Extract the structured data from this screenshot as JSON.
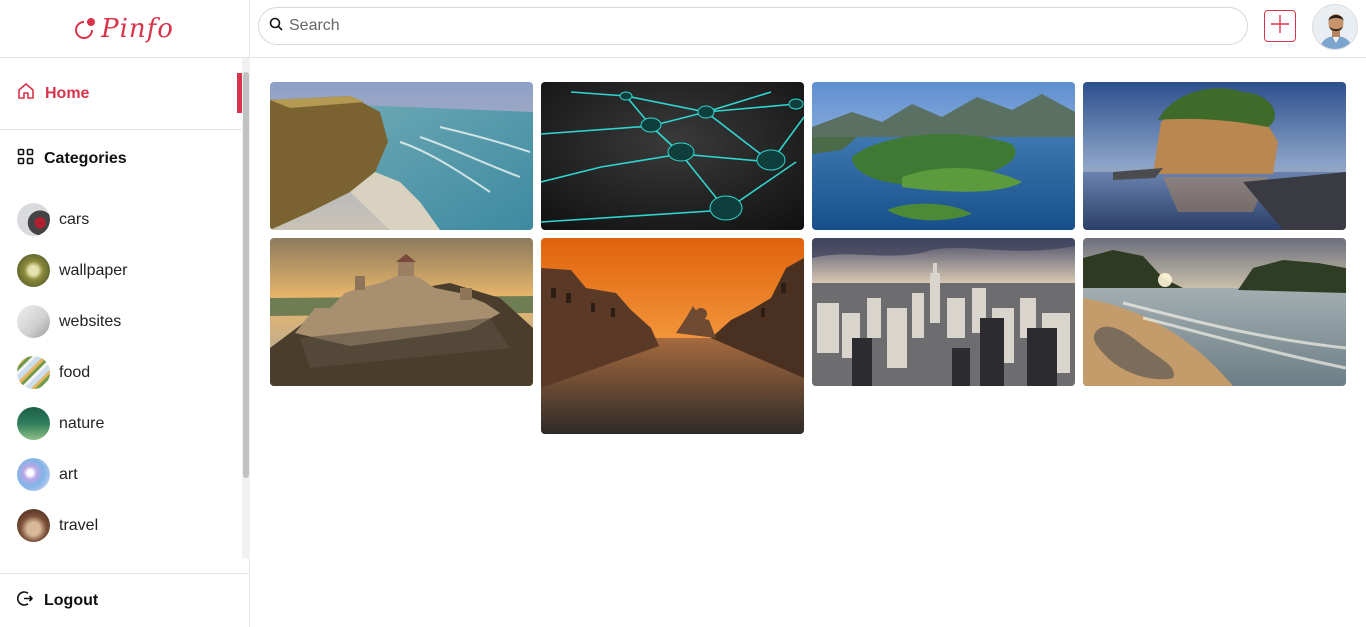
{
  "app": {
    "logo_text": "Pinfo",
    "brand_color": "#d8344b"
  },
  "sidebar": {
    "home_label": "Home",
    "categories_label": "Categories",
    "categories": [
      {
        "label": "cars"
      },
      {
        "label": "wallpaper"
      },
      {
        "label": "websites"
      },
      {
        "label": "food"
      },
      {
        "label": "nature"
      },
      {
        "label": "art"
      },
      {
        "label": "travel"
      }
    ],
    "logout_label": "Logout"
  },
  "search": {
    "placeholder": "Search",
    "value": ""
  },
  "header": {
    "add_icon": "plus-icon",
    "avatar_icon": "user-avatar"
  },
  "pins": [
    {
      "subject": "coastal-cliffs"
    },
    {
      "subject": "network-nodes"
    },
    {
      "subject": "islands-aerial"
    },
    {
      "subject": "rock-island"
    },
    {
      "subject": "hill-fortress"
    },
    {
      "subject": "venice-canal"
    },
    {
      "subject": "city-skyline"
    },
    {
      "subject": "beach-sunset"
    }
  ]
}
